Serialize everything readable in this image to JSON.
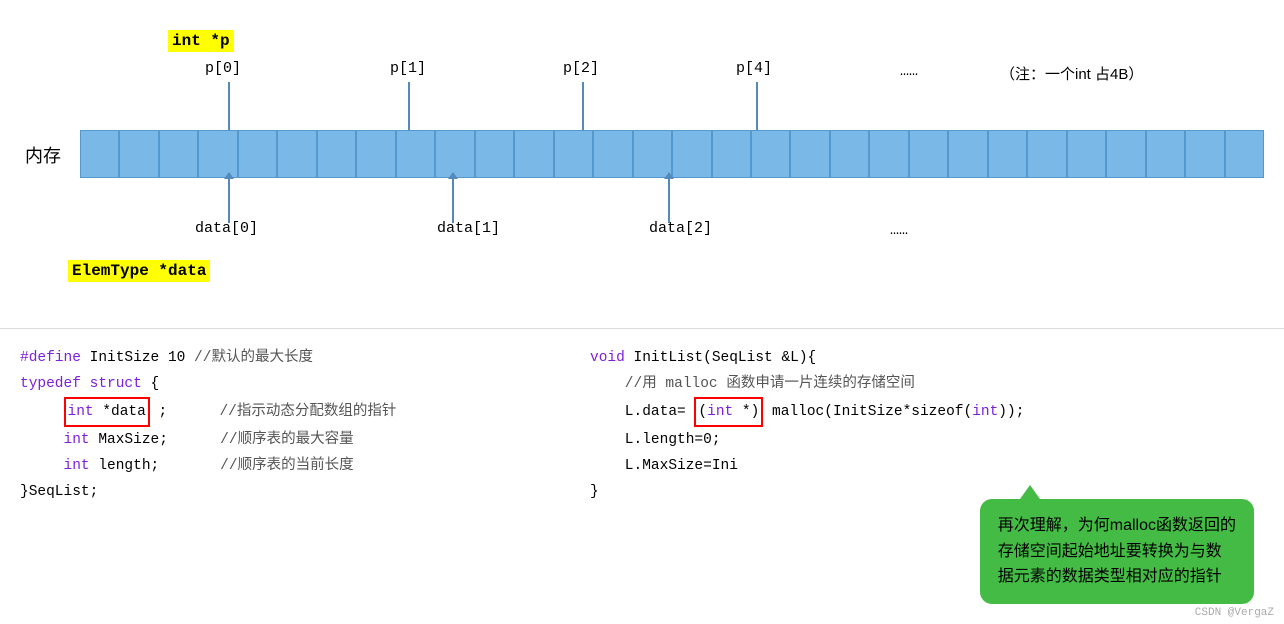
{
  "diagram": {
    "memory_label": "内存",
    "int_p_label": "int *p",
    "p_labels": [
      "p[0]",
      "p[1]",
      "p[2]",
      "p[4]",
      "……"
    ],
    "note": "（注：一个int 占4B）",
    "data_labels": [
      "data[0]",
      "data[1]",
      "data[2]",
      "……"
    ],
    "elemtype_label": "ElemType *data"
  },
  "code_left": {
    "line1": "#define InitSize 10 //默认的最大长度",
    "line2": "typedef struct{",
    "line3_prefix": "    ",
    "line3_boxed": "int *data",
    "line3_suffix": ";",
    "line3_comment": "    //指示动态分配数组的指针",
    "line4": "    int MaxSize;      //顺序表的最大容量",
    "line5": "    int length;       //顺序表的当前长度",
    "line6": "}SeqList;"
  },
  "code_right": {
    "line1": "void InitList(SeqList &L){",
    "line2": "    //用 malloc 函数申请一片连续的存储空间",
    "line3_prefix": "    L.data=",
    "line3_boxed": "(int *)",
    "line3_suffix": "malloc(InitSize*sizeof(int));",
    "line4": "    L.length=0;",
    "line5": "    L.MaxSize=Ini",
    "line6": "}"
  },
  "tooltip": {
    "text": "再次理解，为何malloc函数返回的\n存储空间起始地址要转换为与数\n据元素的数据类型相对应的指针"
  },
  "credit": {
    "text": "CSDN @VergaZ"
  }
}
